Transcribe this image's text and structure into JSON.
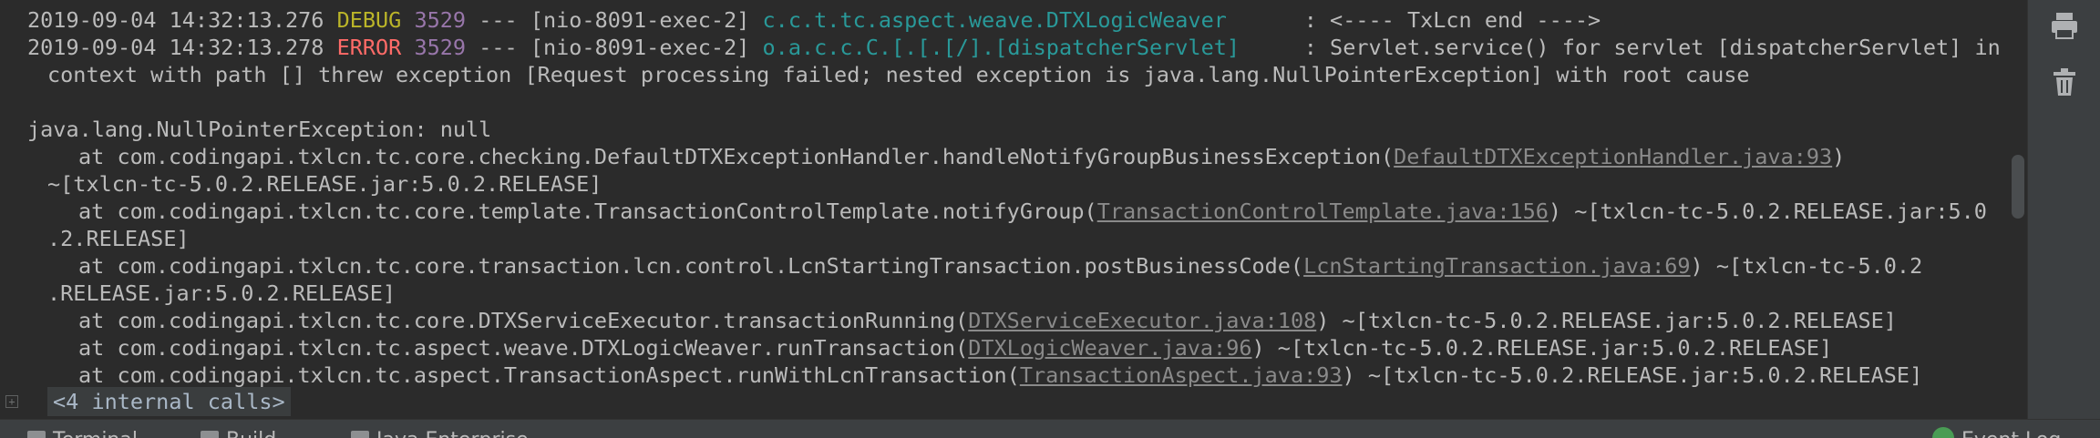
{
  "log_lines": [
    {
      "timestamp": "2019-09-04 14:32:13.276",
      "level": "DEBUG",
      "pid": "3529",
      "sep": "---",
      "thread": "[nio-8091-exec-2]",
      "logger": "c.c.t.tc.aspect.weave.DTXLogicWeaver",
      "message": ": <---- TxLcn end ---->"
    },
    {
      "timestamp": "2019-09-04 14:32:13.278",
      "level": "ERROR",
      "pid": "3529",
      "sep": "---",
      "thread": "[nio-8091-exec-2]",
      "logger": "o.a.c.c.C.[.[.[/].[dispatcherServlet]",
      "message": ": Servlet.service() for servlet [dispatcherServlet] in",
      "message_cont": "context with path [] threw exception [Request processing failed; nested exception is java.lang.NullPointerException] with root cause"
    }
  ],
  "exception": {
    "header": "java.lang.NullPointerException: null",
    "frames": [
      {
        "text": "at com.codingapi.txlcn.tc.core.checking.DefaultDTXExceptionHandler.handleNotifyGroupBusinessException(",
        "link": "DefaultDTXExceptionHandler.java:93",
        "after": ")",
        "cont": "~[txlcn-tc-5.0.2.RELEASE.jar:5.0.2.RELEASE]"
      },
      {
        "text": "at com.codingapi.txlcn.tc.core.template.TransactionControlTemplate.notifyGroup(",
        "link": "TransactionControlTemplate.java:156",
        "after": ") ~[txlcn-tc-5.0.2.RELEASE.jar:5.0",
        "cont": ".2.RELEASE]"
      },
      {
        "text": "at com.codingapi.txlcn.tc.core.transaction.lcn.control.LcnStartingTransaction.postBusinessCode(",
        "link": "LcnStartingTransaction.java:69",
        "after": ") ~[txlcn-tc-5.0.2",
        "cont": ".RELEASE.jar:5.0.2.RELEASE]"
      },
      {
        "text": "at com.codingapi.txlcn.tc.core.DTXServiceExecutor.transactionRunning(",
        "link": "DTXServiceExecutor.java:108",
        "after": ") ~[txlcn-tc-5.0.2.RELEASE.jar:5.0.2.RELEASE]"
      },
      {
        "text": "at com.codingapi.txlcn.tc.aspect.weave.DTXLogicWeaver.runTransaction(",
        "link": "DTXLogicWeaver.java:96",
        "after": ") ~[txlcn-tc-5.0.2.RELEASE.jar:5.0.2.RELEASE]"
      },
      {
        "text": "at com.codingapi.txlcn.tc.aspect.TransactionAspect.runWithLcnTransaction(",
        "link": "TransactionAspect.java:93",
        "after": ") ~[txlcn-tc-5.0.2.RELEASE.jar:5.0.2.RELEASE]"
      }
    ],
    "internal_calls": "<4 internal calls>"
  },
  "toolbar": {
    "icons": [
      "printer-icon",
      "trash-icon"
    ]
  },
  "statusbar": {
    "tabs": [
      "Terminal",
      "Build",
      "Java Enterprise"
    ],
    "event_log": "Event Log"
  },
  "colors": {
    "background": "#2b2b2b",
    "debug": "#bbb529",
    "error": "#ff6b68",
    "pid": "#9876aa",
    "logger": "#299999",
    "link": "#8a8a8a"
  }
}
